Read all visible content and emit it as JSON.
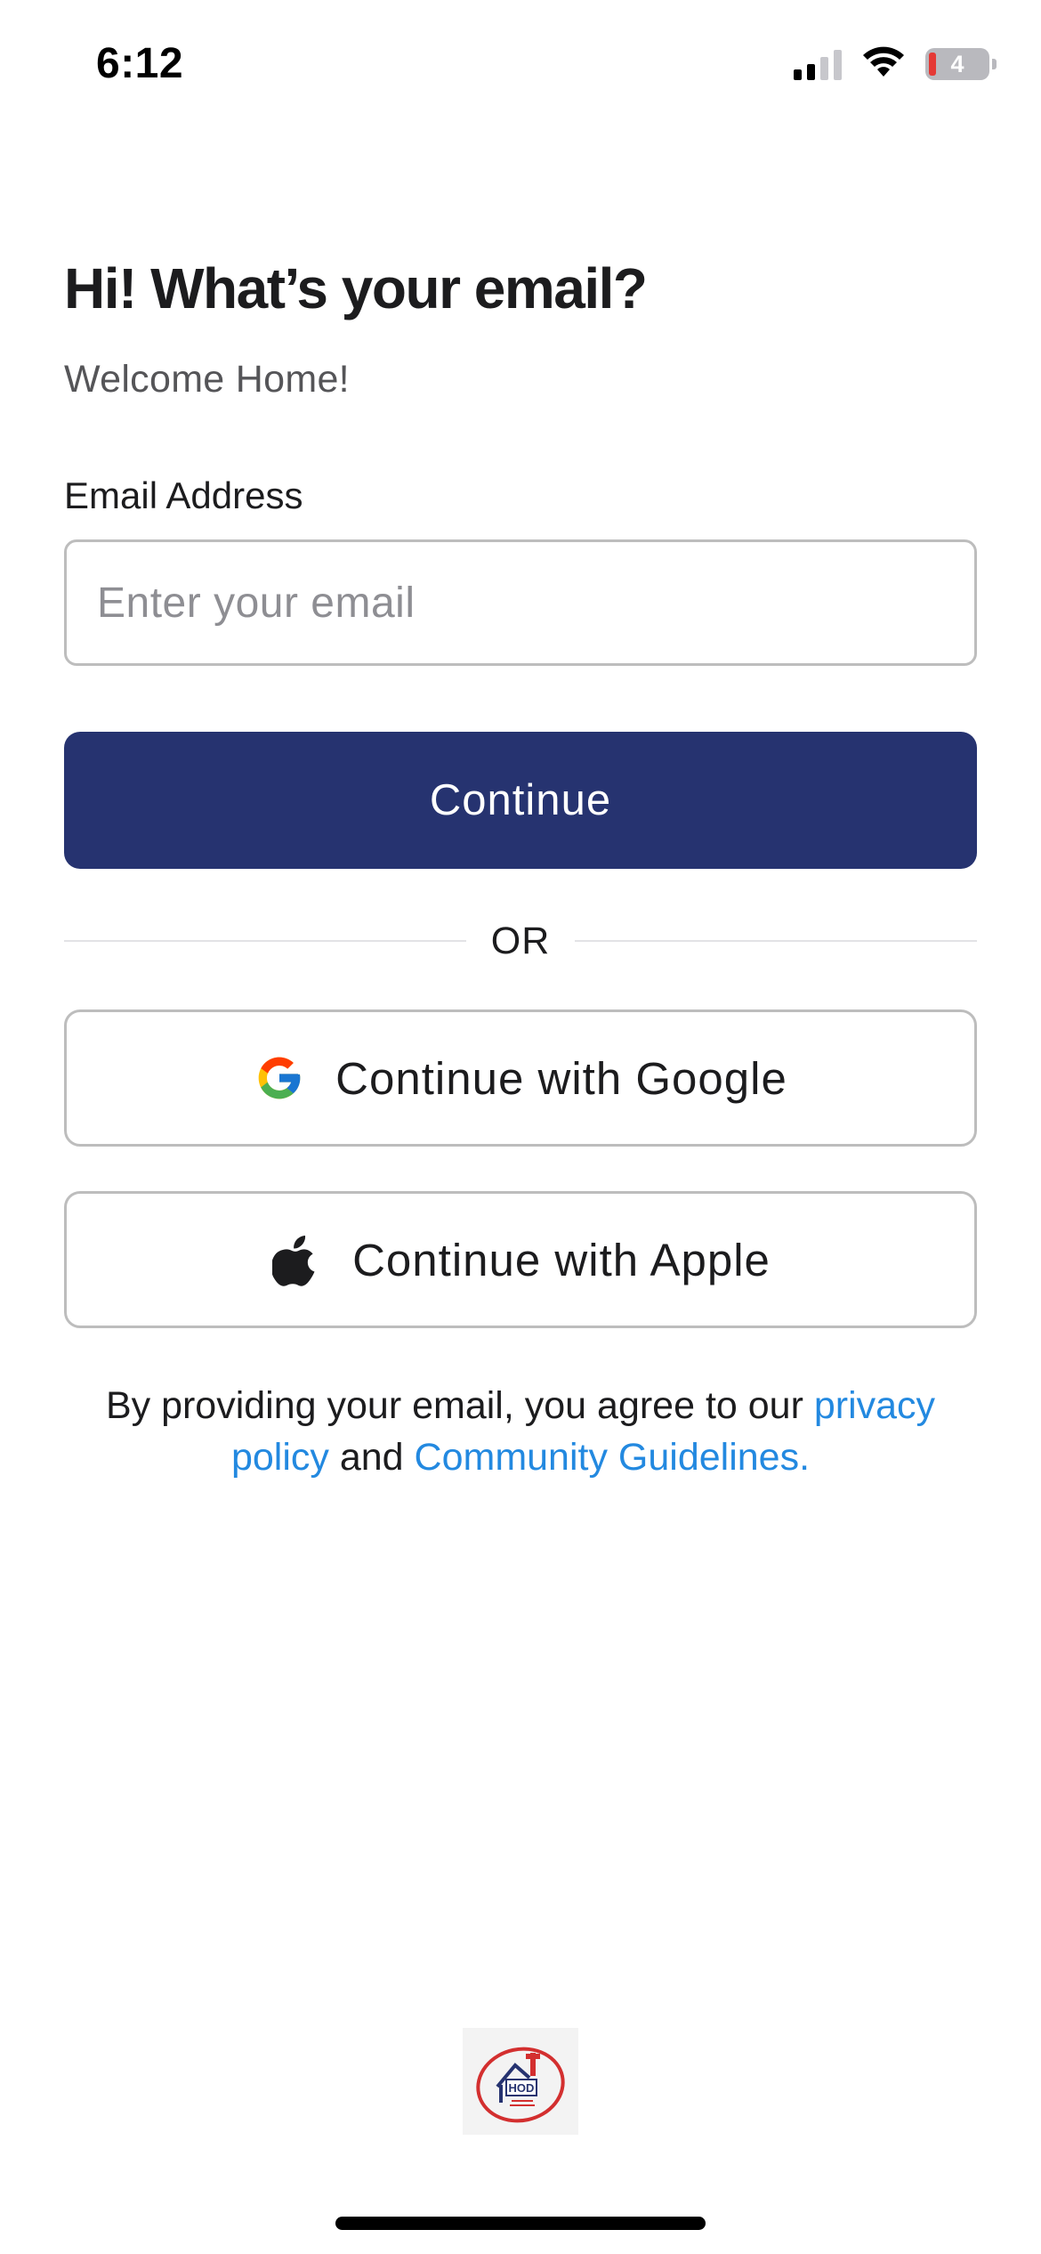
{
  "status_bar": {
    "time": "6:12",
    "battery_level": "4",
    "icons": [
      "cellular-signal-icon",
      "wifi-icon",
      "battery-icon"
    ]
  },
  "header": {
    "title": "Hi! What’s your email?",
    "subtitle": "Welcome Home!"
  },
  "form": {
    "email_label": "Email Address",
    "email_placeholder": "Enter your email",
    "email_value": "",
    "continue_label": "Continue"
  },
  "divider": {
    "text": "OR"
  },
  "social": {
    "google_label": "Continue with Google",
    "apple_label": "Continue with Apple"
  },
  "legal": {
    "prefix": "By providing your email, you agree to our ",
    "privacy_link": "privacy policy",
    "middle": " and ",
    "guidelines_link": "Community Guidelines."
  },
  "logo": {
    "text": "HOD"
  },
  "colors": {
    "primary": "#263370",
    "link": "#2389e0",
    "border": "#bdbdbd",
    "battery_low": "#e53935"
  }
}
